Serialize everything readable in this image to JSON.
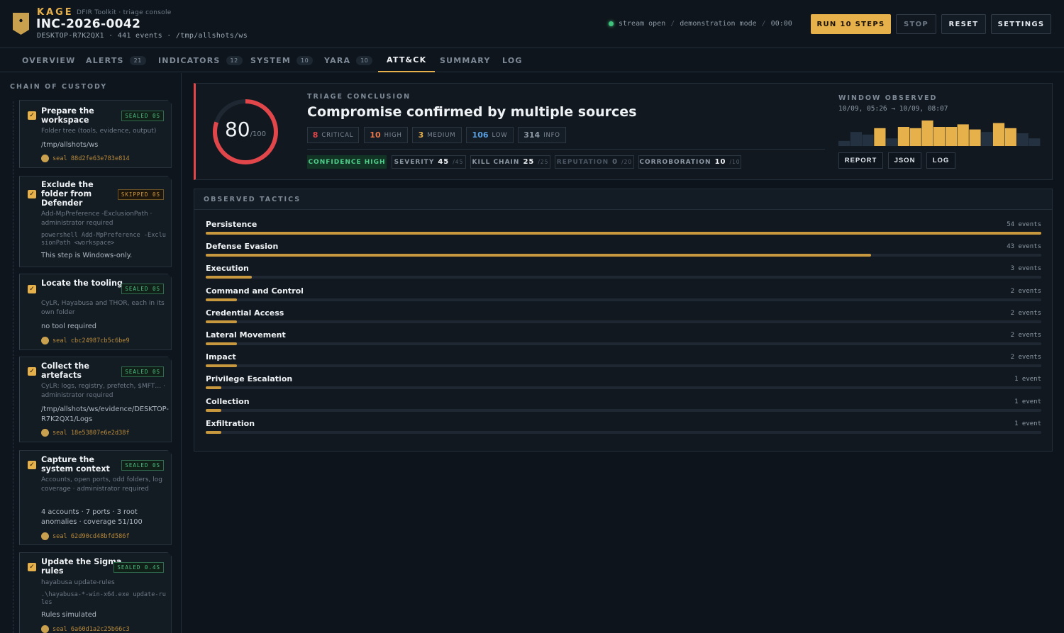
{
  "header": {
    "brand": "KAGE",
    "brand_sub": "DFIR Toolkit · triage console",
    "incident": "INC-2026-0042",
    "host_line": "DESKTOP-R7K2QX1 · 441 events · /tmp/allshots/ws",
    "stream": "stream open",
    "mode": "demonstration mode",
    "timer": "00:00",
    "buttons": {
      "run": "RUN 10 STEPS",
      "stop": "STOP",
      "reset": "RESET",
      "settings": "SETTINGS"
    }
  },
  "tabs": [
    {
      "label": "OVERVIEW",
      "count": ""
    },
    {
      "label": "ALERTS",
      "count": "21"
    },
    {
      "label": "INDICATORS",
      "count": "12"
    },
    {
      "label": "SYSTEM",
      "count": "10"
    },
    {
      "label": "YARA",
      "count": "10"
    },
    {
      "label": "ATT&CK",
      "count": ""
    },
    {
      "label": "SUMMARY",
      "count": ""
    },
    {
      "label": "LOG",
      "count": ""
    }
  ],
  "active_tab": "ATT&CK",
  "sidebar": {
    "title": "CHAIN OF CUSTODY",
    "steps": [
      {
        "title": "Prepare the workspace",
        "badge": "SEALED 0S",
        "status": "sealed",
        "desc": "Folder tree (tools, evidence, output)",
        "value": "/tmp/allshots/ws",
        "seal": "seal 88d2fe63e783e814"
      },
      {
        "title": "Exclude the folder from Defender",
        "badge": "SKIPPED 0S",
        "status": "skipped",
        "desc": "Add-MpPreference -ExclusionPath · administrator required",
        "cmd": "powershell Add-MpPreference -ExclusionPath <workspace>",
        "value": "This step is Windows-only."
      },
      {
        "title": "Locate the tooling",
        "badge": "SEALED 0S",
        "status": "sealed",
        "desc": "CyLR, Hayabusa and THOR, each in its own folder",
        "value": "no tool required",
        "seal": "seal cbc24987cb5c6be9"
      },
      {
        "title": "Collect the artefacts",
        "badge": "SEALED 0S",
        "status": "sealed",
        "desc": "CyLR: logs, registry, prefetch, $MFT… · administrator required",
        "value": "/tmp/allshots/ws/evidence/DESKTOP-R7K2QX1/Logs",
        "seal": "seal 18e53807e6e2d38f"
      },
      {
        "title": "Capture the system context",
        "badge": "SEALED 0S",
        "status": "sealed",
        "desc": "Accounts, open ports, odd folders, log coverage · administrator required",
        "value": "4 accounts · 7 ports · 3 root anomalies · coverage 51/100",
        "seal": "seal 62d90cd48bfd586f"
      },
      {
        "title": "Update the Sigma rules",
        "badge": "SEALED 0.4S",
        "status": "sealed",
        "desc": "hayabusa update-rules",
        "cmd": ".\\hayabusa-*-win-x64.exe update-rules",
        "value": "Rules simulated",
        "seal": "seal 6a60d1a2c25b66c3"
      }
    ]
  },
  "conclusion": {
    "score": "80",
    "score_max": "/100",
    "score_value": 80,
    "accent": "#e0464a",
    "kicker": "TRIAGE CONCLUSION",
    "headline": "Compromise confirmed by multiple sources",
    "counts": [
      {
        "n": "8",
        "label": "CRITICAL",
        "color": "#e0464a"
      },
      {
        "n": "10",
        "label": "HIGH",
        "color": "#e8774a"
      },
      {
        "n": "3",
        "label": "MEDIUM",
        "color": "#e6b04a"
      },
      {
        "n": "106",
        "label": "LOW",
        "color": "#5aa0e0"
      },
      {
        "n": "314",
        "label": "INFO",
        "color": "#8c98a4"
      }
    ],
    "metrics": [
      {
        "label": "CONFIDENCE HIGH",
        "value": "",
        "max": ""
      },
      {
        "label": "SEVERITY",
        "value": "45",
        "max": "/45"
      },
      {
        "label": "KILL CHAIN",
        "value": "25",
        "max": "/25"
      },
      {
        "label": "REPUTATION",
        "value": "0",
        "max": "/20"
      },
      {
        "label": "CORROBORATION",
        "value": "10",
        "max": "/10"
      }
    ],
    "window_title": "WINDOW OBSERVED",
    "window_range": "10/09, 05:26 → 10/09, 08:07",
    "histogram": [
      0.2,
      0.55,
      0.45,
      0.7,
      0.3,
      0.75,
      0.7,
      1.0,
      0.75,
      0.75,
      0.85,
      0.65,
      0.55,
      0.9,
      0.7,
      0.5,
      0.3
    ],
    "histogram_highlight": [
      false,
      false,
      false,
      true,
      false,
      true,
      true,
      true,
      true,
      true,
      true,
      true,
      false,
      true,
      true,
      false,
      false
    ],
    "actions": [
      "REPORT",
      "JSON",
      "LOG"
    ]
  },
  "tactics": {
    "title": "OBSERVED TACTICS",
    "items": [
      {
        "name": "Persistence",
        "count": "54 events",
        "value": 54
      },
      {
        "name": "Defense Evasion",
        "count": "43 events",
        "value": 43
      },
      {
        "name": "Execution",
        "count": "3 events",
        "value": 3
      },
      {
        "name": "Command and Control",
        "count": "2 events",
        "value": 2
      },
      {
        "name": "Credential Access",
        "count": "2 events",
        "value": 2
      },
      {
        "name": "Lateral Movement",
        "count": "2 events",
        "value": 2
      },
      {
        "name": "Impact",
        "count": "2 events",
        "value": 2
      },
      {
        "name": "Privilege Escalation",
        "count": "1 event",
        "value": 1
      },
      {
        "name": "Collection",
        "count": "1 event",
        "value": 1
      },
      {
        "name": "Exfiltration",
        "count": "1 event",
        "value": 1
      }
    ]
  }
}
